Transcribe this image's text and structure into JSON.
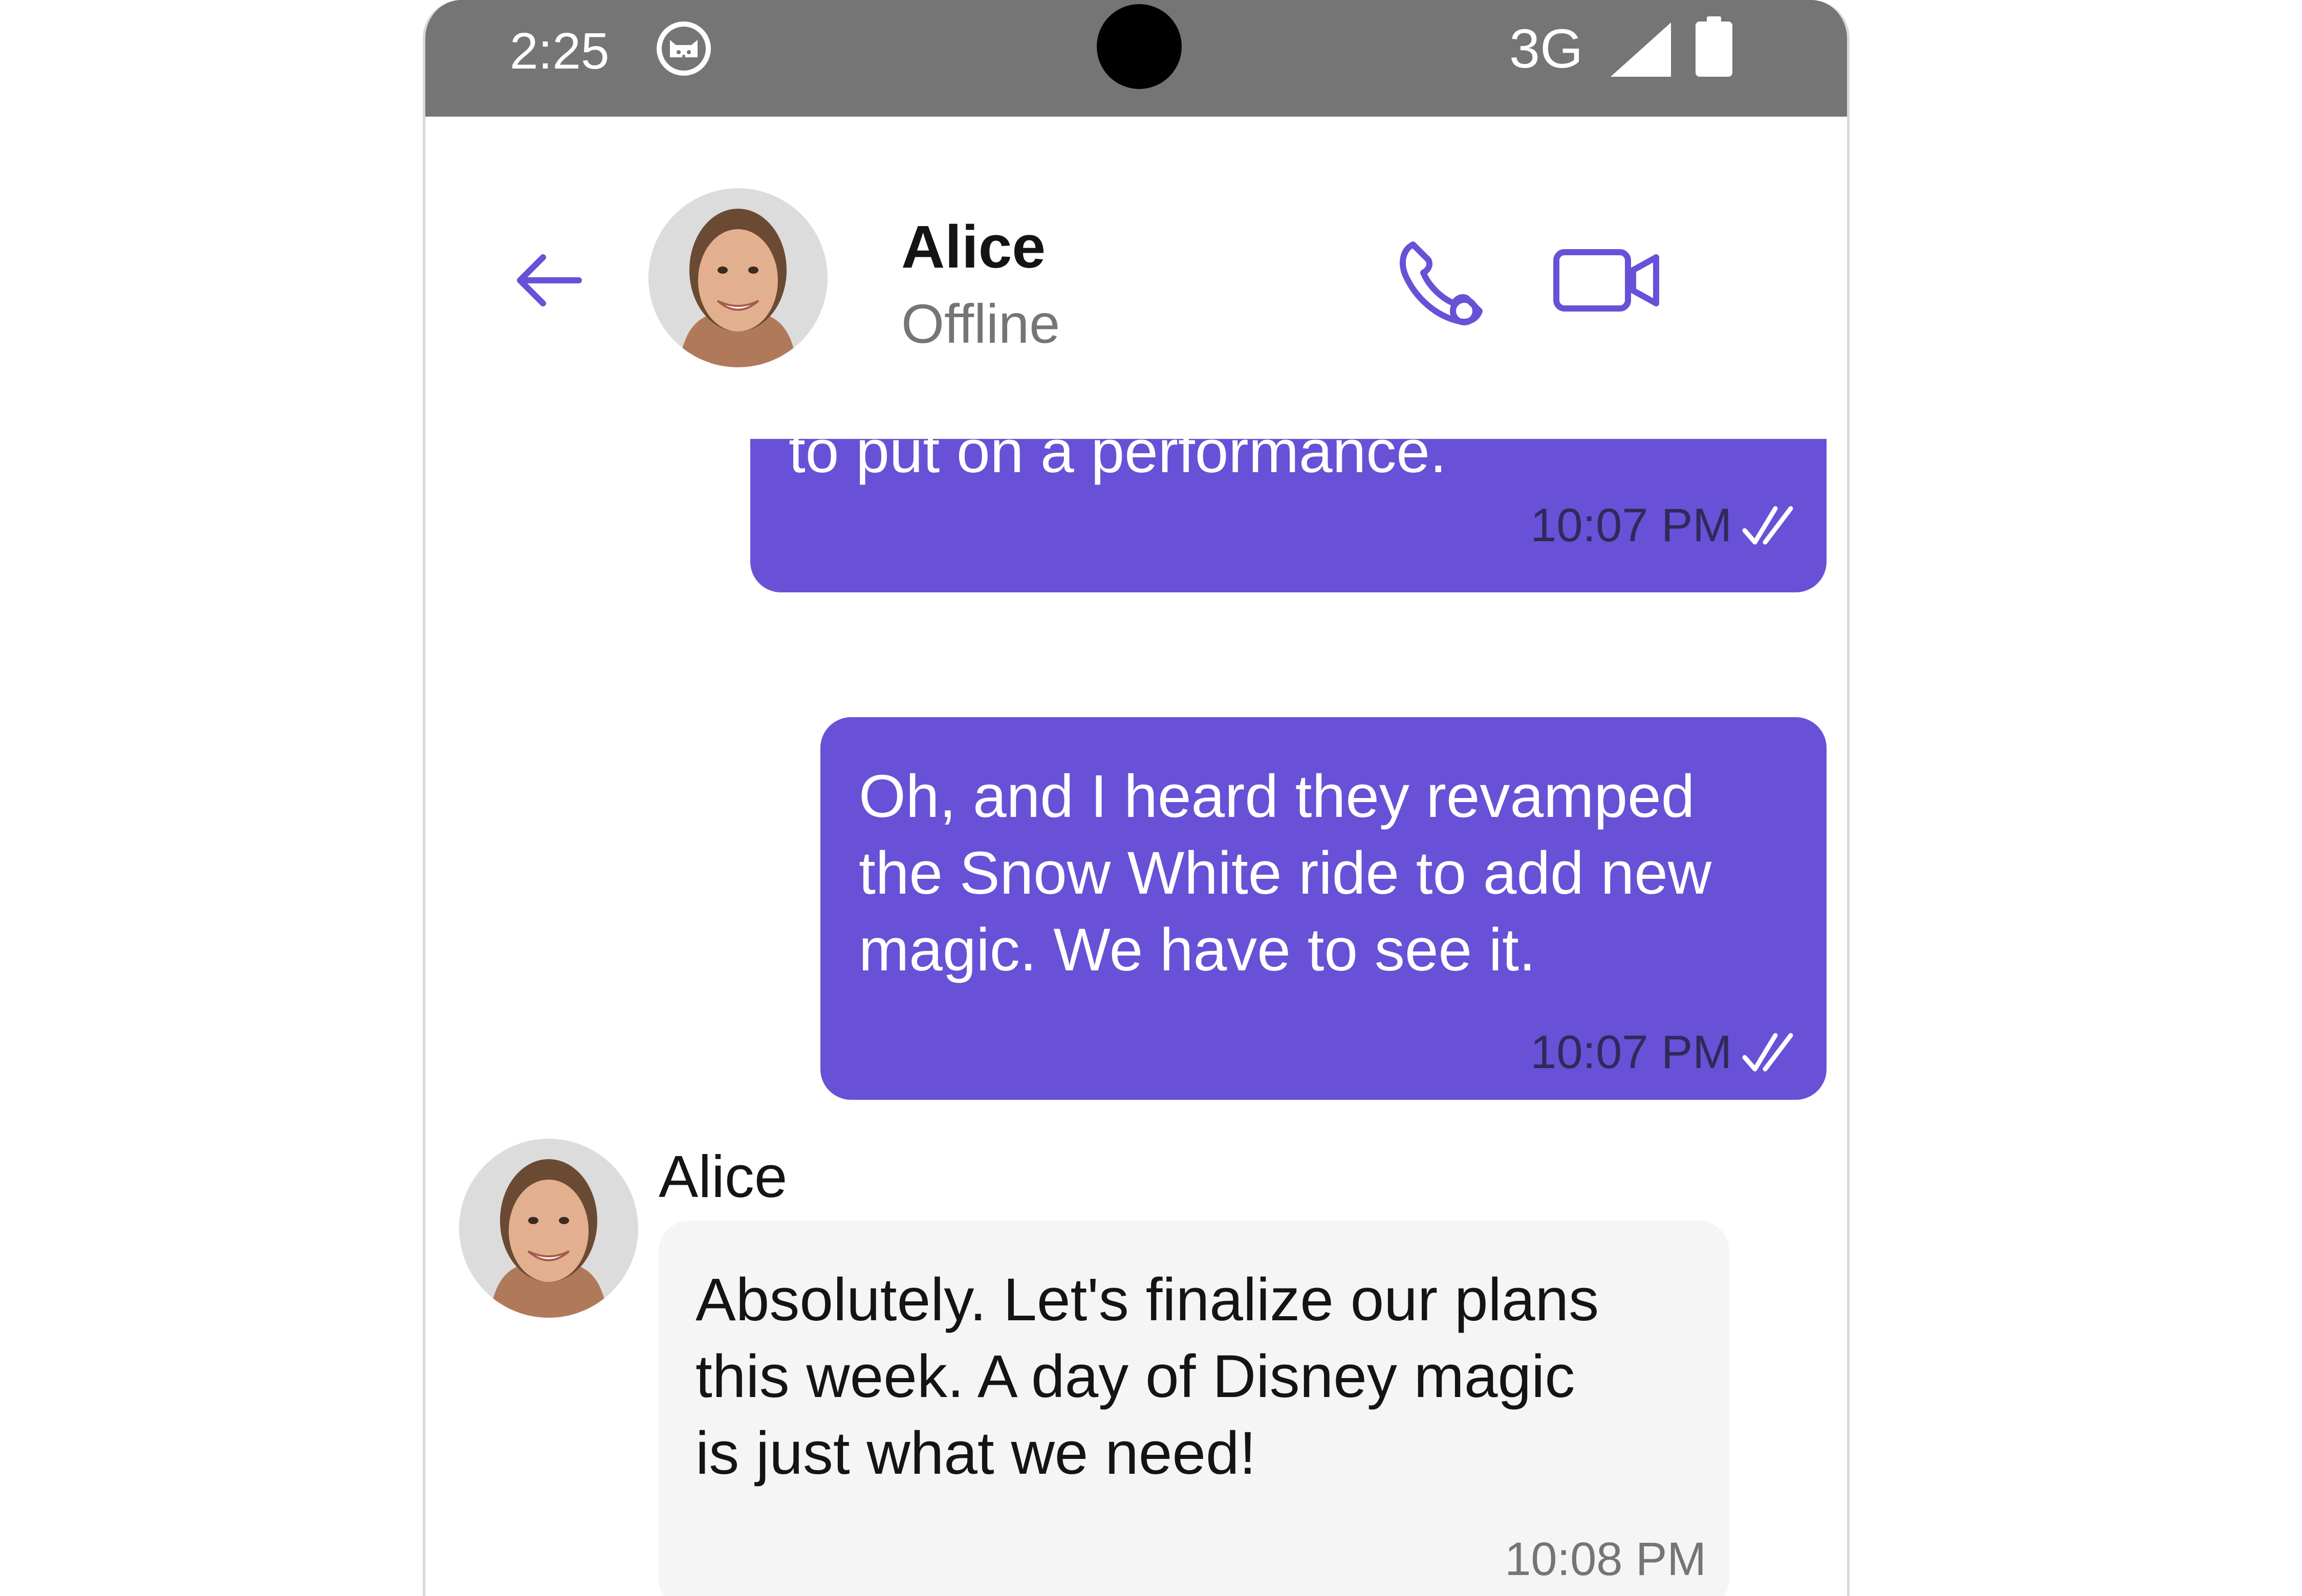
{
  "status_bar": {
    "time": "2:25",
    "network": "3G",
    "icons": [
      "cat-face-icon",
      "signal-icon",
      "battery-icon"
    ]
  },
  "header": {
    "name": "Alice",
    "status": "Offline",
    "icons": [
      "back-arrow-icon",
      "phone-icon",
      "video-camera-icon"
    ]
  },
  "colors": {
    "accent": "#6851d6",
    "outgoing_bubble": "#6851d6",
    "incoming_bubble": "#f5f5f5",
    "status_bar": "#757575"
  },
  "messages": [
    {
      "direction": "outgoing",
      "text": "to put on a performance.",
      "time": "10:07 PM",
      "receipt": "read"
    },
    {
      "direction": "outgoing",
      "text": "Oh, and I heard they revamped\nthe Snow White ride to add new\nmagic. We have to see it.",
      "time": "10:07 PM",
      "receipt": "read"
    },
    {
      "direction": "incoming",
      "sender": "Alice",
      "text": "Absolutely. Let's finalize our plans\nthis week. A day of Disney magic\nis just what we need!",
      "time": "10:08 PM"
    }
  ]
}
